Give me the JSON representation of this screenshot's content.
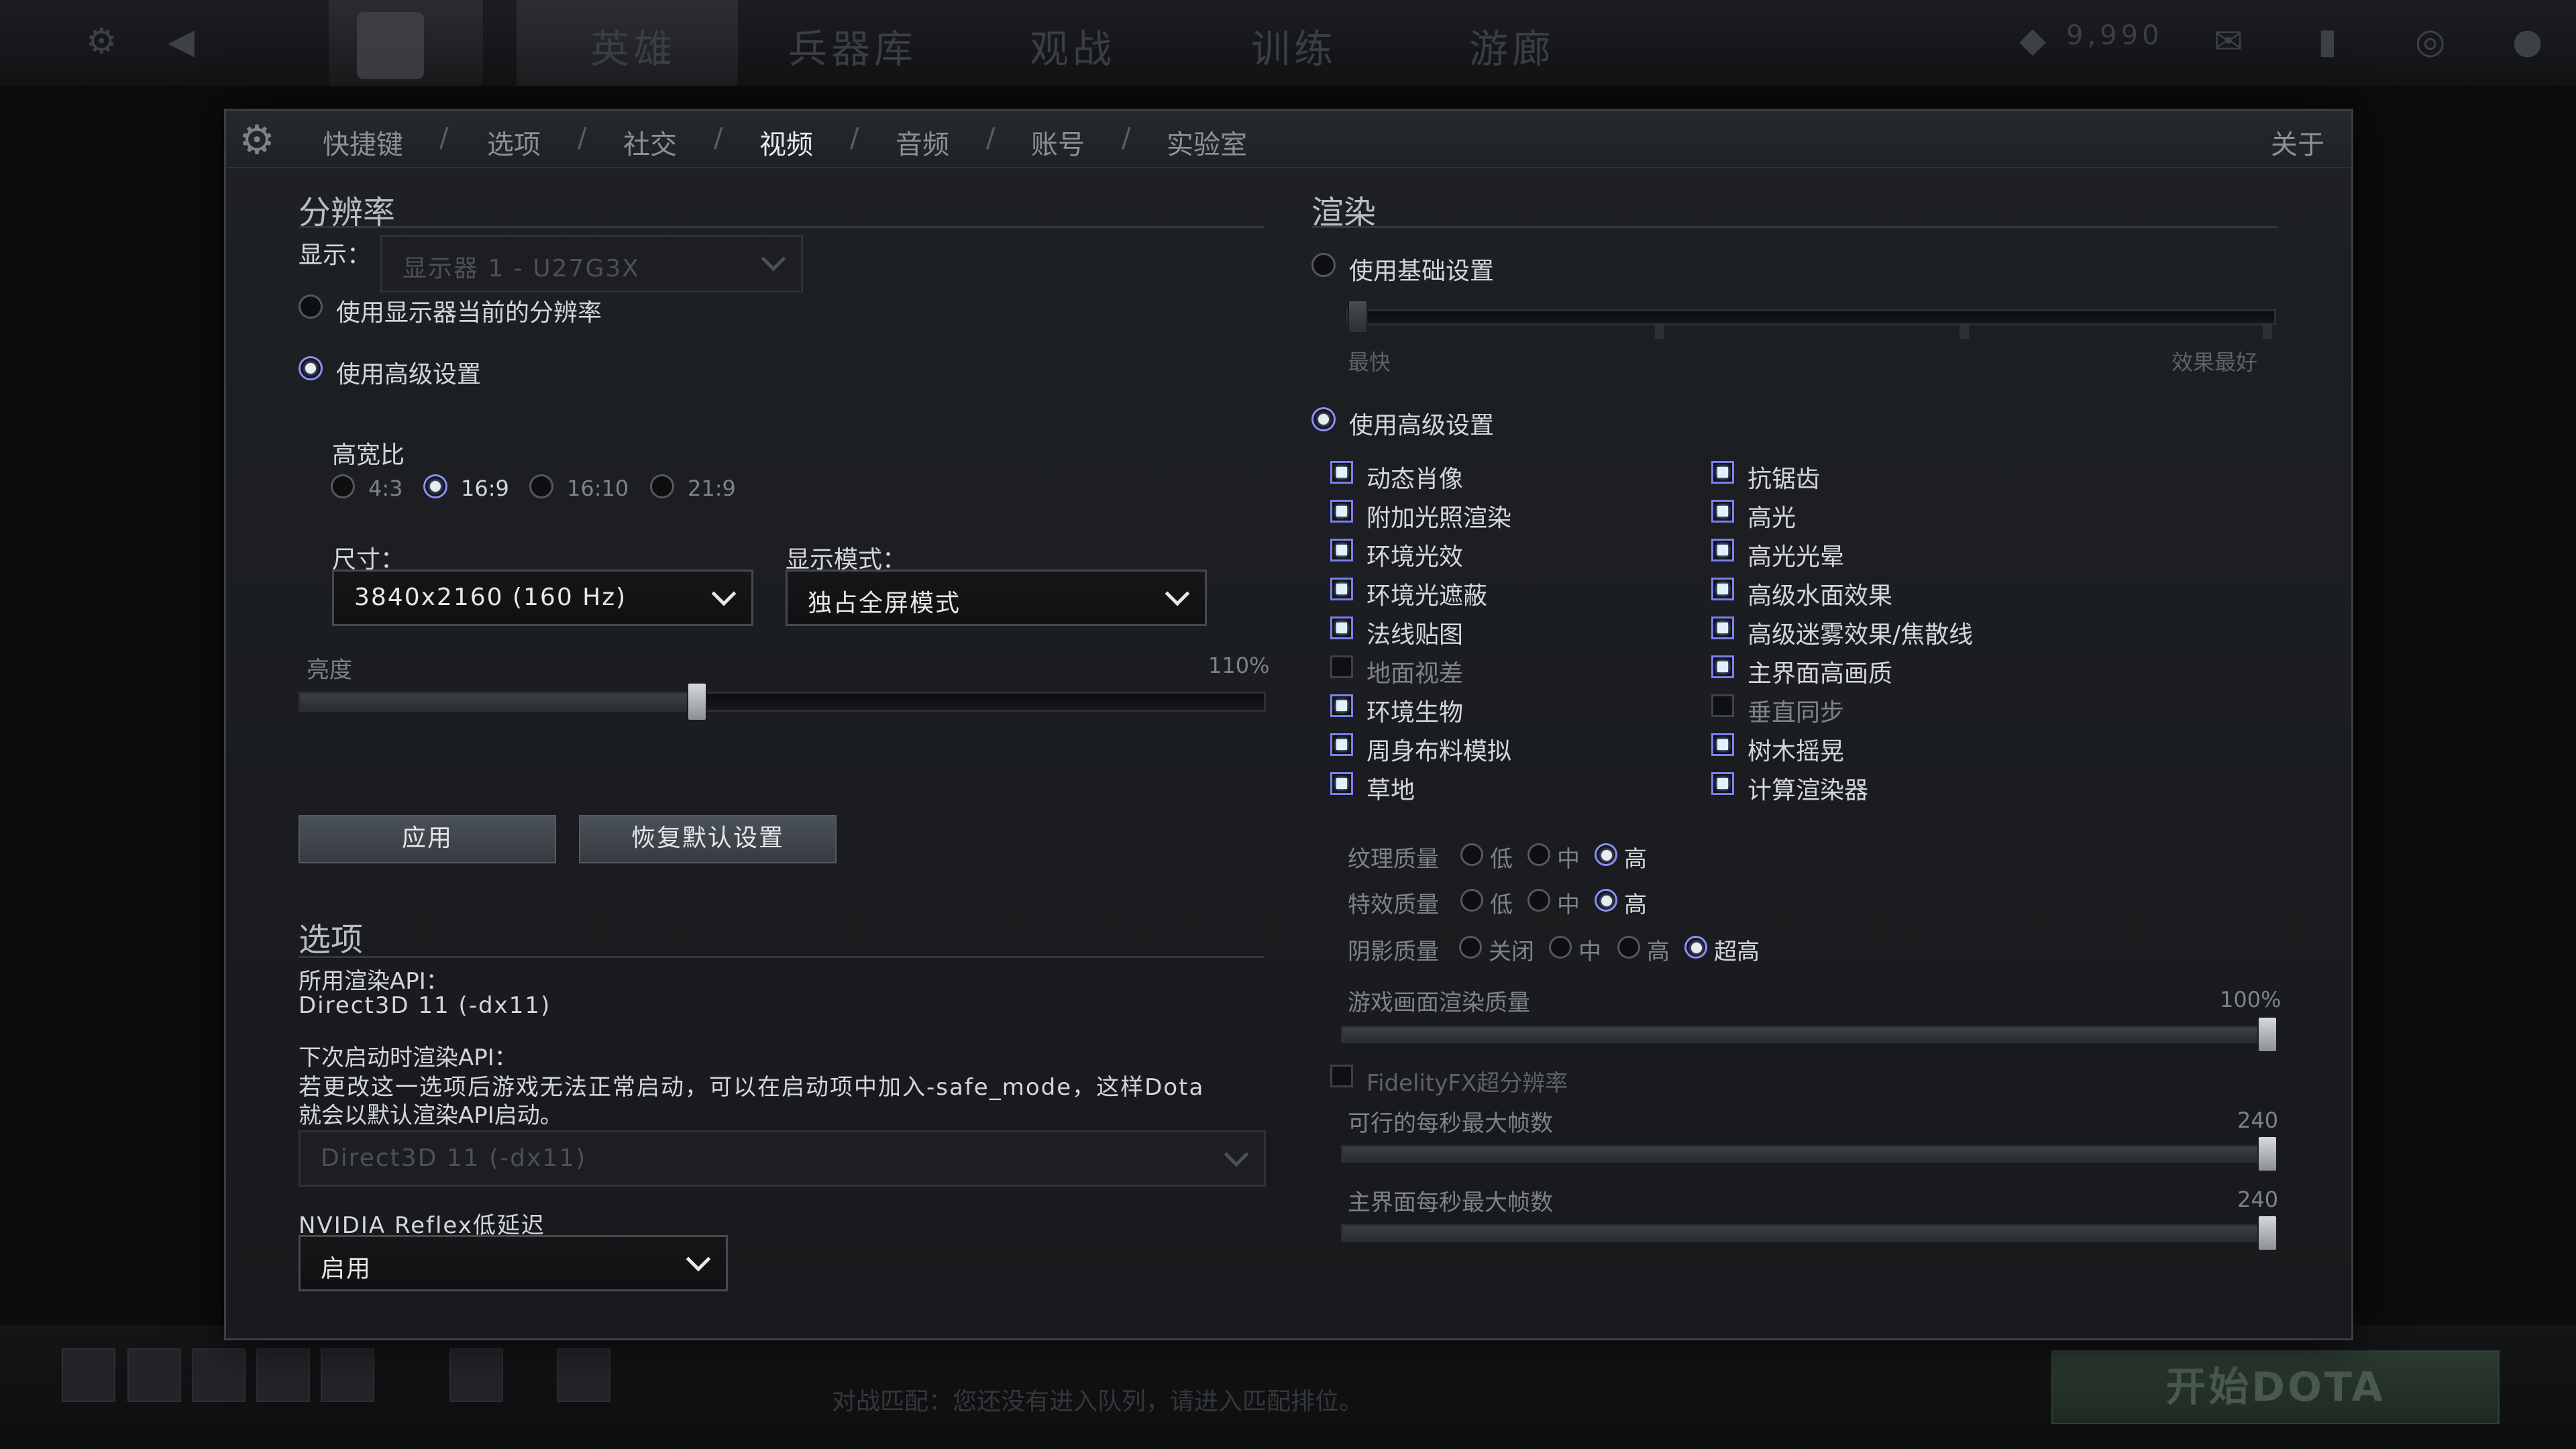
{
  "background": {
    "nav": [
      "英雄",
      "兵器库",
      "观战",
      "训练",
      "游廊"
    ],
    "currency": "9,990",
    "play_button": "开始DOTA",
    "status_text": "对战匹配：您还没有进入队列，请进入匹配排位。"
  },
  "tabs": {
    "items": [
      "快捷键",
      "选项",
      "社交",
      "视频",
      "音频",
      "账号",
      "实验室"
    ],
    "separator": "/",
    "active": "视频",
    "about": "关于"
  },
  "resolution": {
    "title": "分辨率",
    "display_label": "显示：",
    "display_value": "显示器 1 - U27G3X",
    "use_current": "使用显示器当前的分辨率",
    "use_advanced": "使用高级设置",
    "aspect_title": "高宽比",
    "aspect_options": [
      "4:3",
      "16:9",
      "16:10",
      "21:9"
    ],
    "aspect_selected": "16:9",
    "size_label": "尺寸：",
    "size_value": "3840x2160 (160 Hz)",
    "mode_label": "显示模式：",
    "mode_value": "独占全屏模式",
    "brightness_label": "亮度",
    "brightness_value": "110%",
    "brightness_level": 0.41,
    "apply": "应用",
    "restore": "恢复默认设置"
  },
  "options": {
    "title": "选项",
    "api_label": "所用渲染API：",
    "api_value": "Direct3D 11 (-dx11)",
    "next_api_label": "下次启动时渲染API：",
    "next_api_note_line1": "若更改这一选项后游戏无法正常启动，可以在启动项中加入-safe_mode，这样Dota",
    "next_api_note_line2": "就会以默认渲染API启动。",
    "next_api_value": "Direct3D 11 (-dx11)",
    "reflex_label": "NVIDIA Reflex低延迟",
    "reflex_value": "启用"
  },
  "render": {
    "title": "渲染",
    "use_basic": "使用基础设置",
    "basic_min": "最快",
    "basic_max": "效果最好",
    "basic_level": 0,
    "use_advanced": "使用高级设置",
    "left_checks": [
      {
        "label": "动态肖像",
        "checked": true
      },
      {
        "label": "附加光照渲染",
        "checked": true
      },
      {
        "label": "环境光效",
        "checked": true
      },
      {
        "label": "环境光遮蔽",
        "checked": true
      },
      {
        "label": "法线贴图",
        "checked": true
      },
      {
        "label": "地面视差",
        "checked": false
      },
      {
        "label": "环境生物",
        "checked": true
      },
      {
        "label": "周身布料模拟",
        "checked": true
      },
      {
        "label": "草地",
        "checked": true
      }
    ],
    "right_checks": [
      {
        "label": "抗锯齿",
        "checked": true
      },
      {
        "label": "高光",
        "checked": true
      },
      {
        "label": "高光光晕",
        "checked": true
      },
      {
        "label": "高级水面效果",
        "checked": true
      },
      {
        "label": "高级迷雾效果/焦散线",
        "checked": true
      },
      {
        "label": "主界面高画质",
        "checked": true
      },
      {
        "label": "垂直同步",
        "checked": false
      },
      {
        "label": "树木摇晃",
        "checked": true
      },
      {
        "label": "计算渲染器",
        "checked": true
      }
    ],
    "texture_label": "纹理质量",
    "texture_options": [
      "低",
      "中",
      "高"
    ],
    "texture_selected": "高",
    "effects_label": "特效质量",
    "effects_options": [
      "低",
      "中",
      "高"
    ],
    "effects_selected": "高",
    "shadow_label": "阴影质量",
    "shadow_options": [
      "关闭",
      "中",
      "高",
      "超高"
    ],
    "shadow_selected": "超高",
    "render_quality_label": "游戏画面渲染质量",
    "render_quality_value": "100%",
    "render_quality_level": 1.0,
    "fsr_label": "FidelityFX超分辨率",
    "fps_label": "可行的每秒最大帧数",
    "fps_value": "240",
    "fps_level": 1.0,
    "menu_fps_label": "主界面每秒最大帧数",
    "menu_fps_value": "240",
    "menu_fps_level": 1.0
  }
}
